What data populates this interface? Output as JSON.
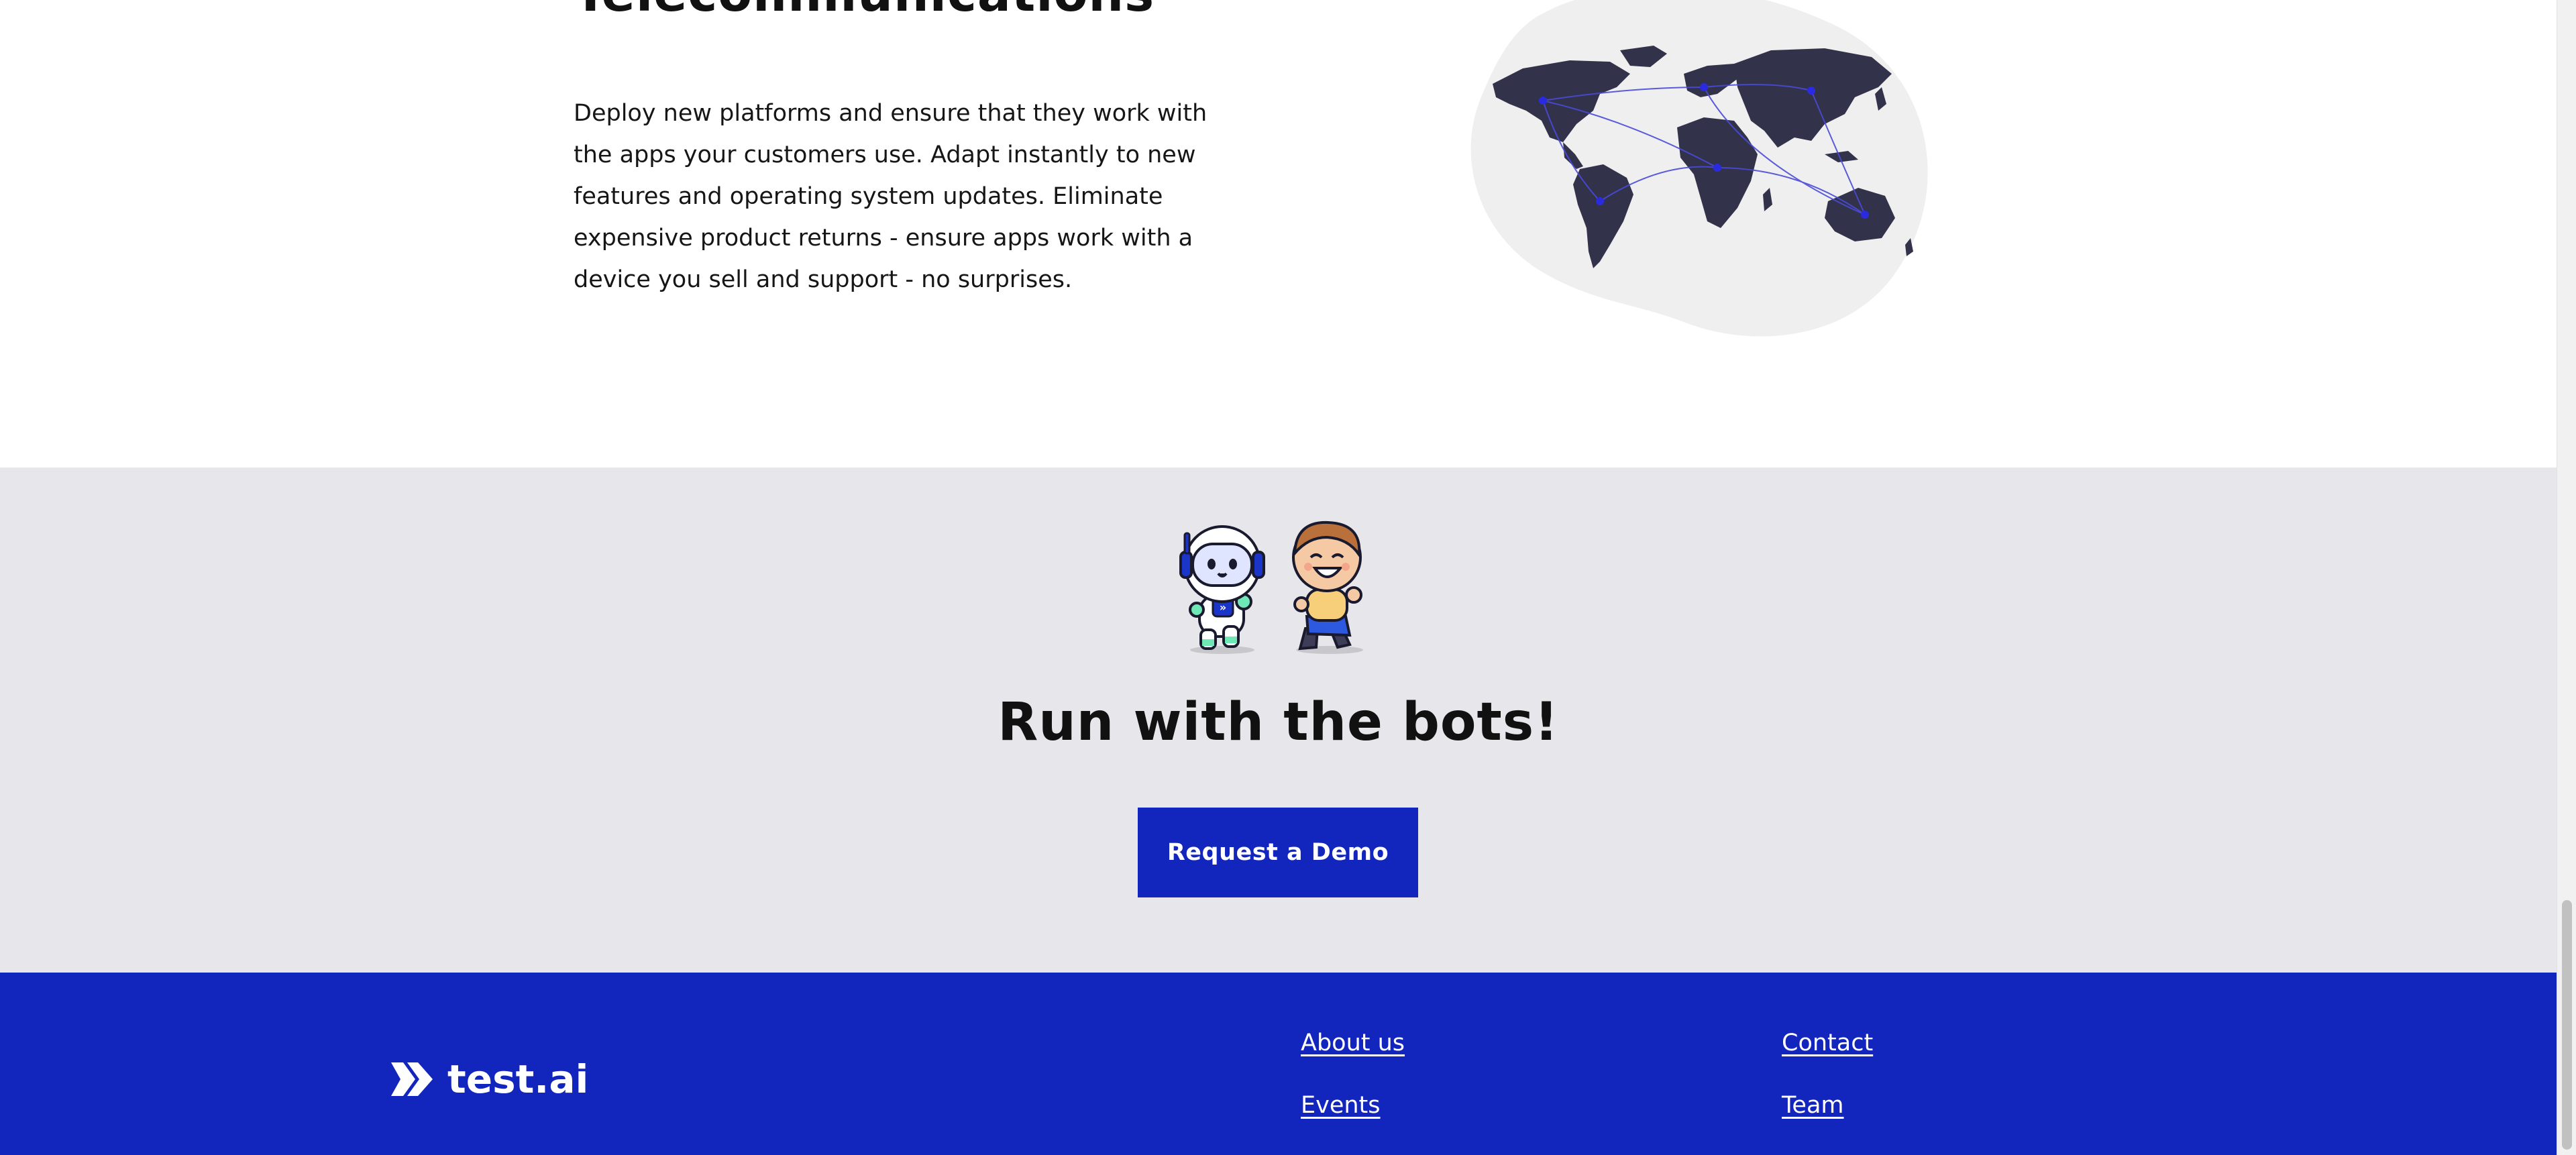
{
  "telecom": {
    "title": "Telecommunications",
    "body": "Deploy new platforms and ensure that they work with the apps your customers use. Adapt instantly to new features and operating system updates. Eliminate expensive product returns - ensure apps work with a device you sell and support - no surprises."
  },
  "cta": {
    "title": "Run with the bots!",
    "button_label": "Request a Demo"
  },
  "footer": {
    "logo_text": "test.ai",
    "links": {
      "about": "About us",
      "events": "Events",
      "contact": "Contact",
      "team": "Team"
    }
  },
  "colors": {
    "brand_blue": "#1226be",
    "cta_background": "#e6e6eb",
    "map_land": "#32324a",
    "map_blob": "#efefef"
  },
  "icons": {
    "world_map": "world-map-illustration",
    "bots": "robot-and-boy-illustration",
    "logo": "test-ai-logo-icon"
  }
}
